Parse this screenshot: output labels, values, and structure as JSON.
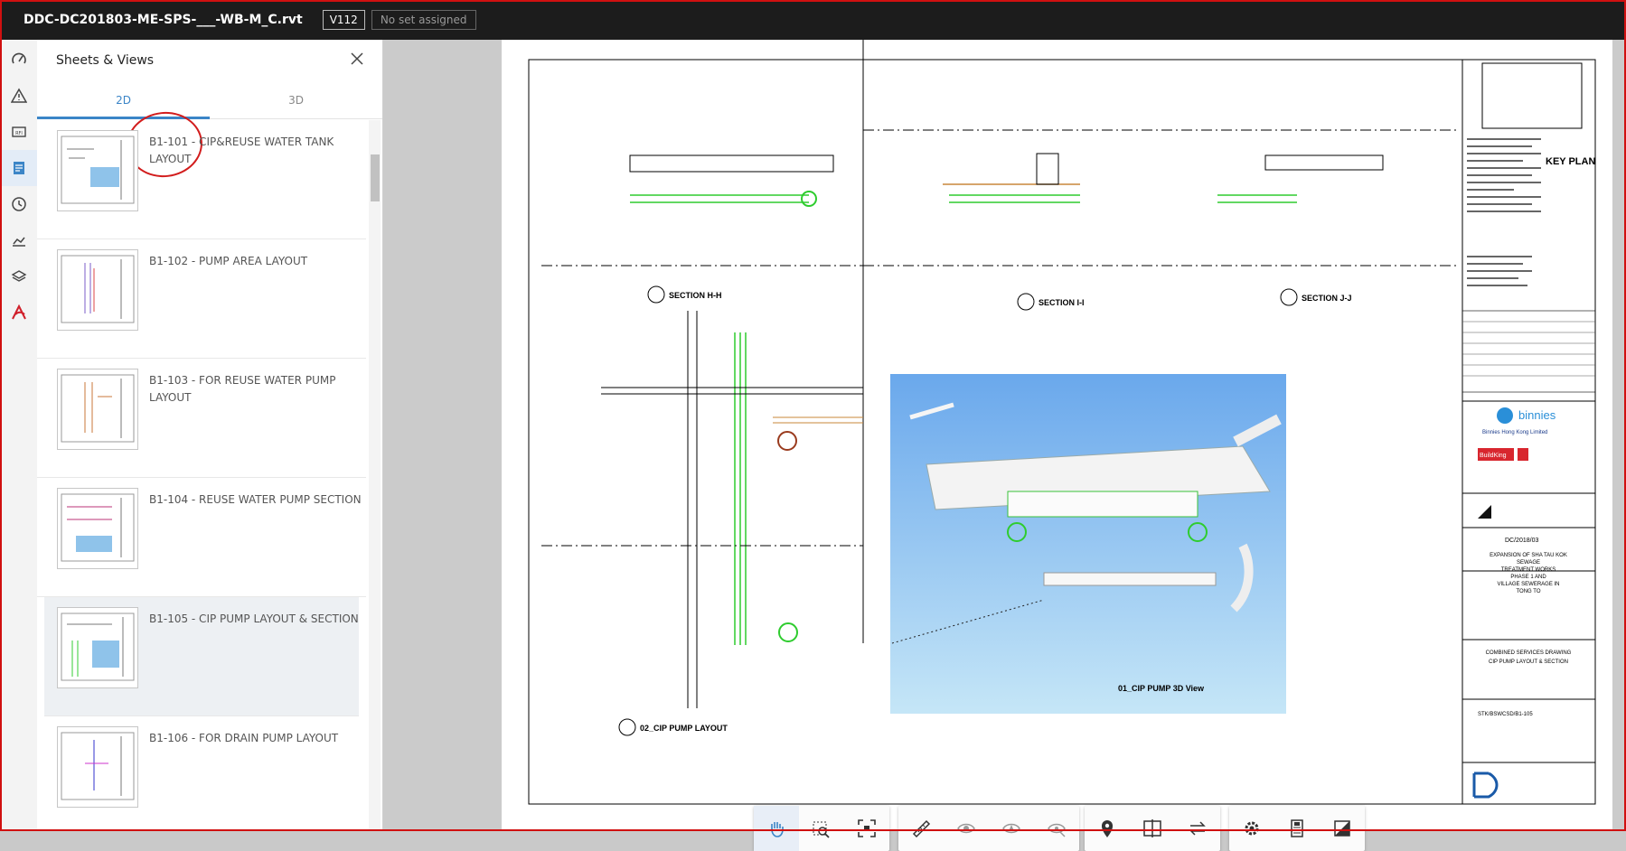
{
  "header": {
    "file_name": "DDC-DC201803-ME-SPS-___-WB-M_C.rvt",
    "version": "V112",
    "set_status": "No set assigned"
  },
  "rail": {
    "icons": [
      "dashboard-icon",
      "warning-icon",
      "rfi-icon",
      "sheets-icon",
      "history-icon",
      "chart-icon",
      "layers-icon",
      "autodesk-icon"
    ]
  },
  "panel": {
    "title": "Sheets & Views",
    "tabs": [
      {
        "label": "2D"
      },
      {
        "label": "3D"
      }
    ],
    "items": [
      {
        "label": "B1-101 - CIP&REUSE WATER TANK LAYOUT"
      },
      {
        "label": "B1-102 - PUMP AREA LAYOUT"
      },
      {
        "label": "B1-103 - FOR REUSE WATER PUMP LAYOUT"
      },
      {
        "label": "B1-104 - REUSE WATER PUMP SECTION"
      },
      {
        "label": "B1-105 - CIP PUMP LAYOUT & SECTION"
      },
      {
        "label": "B1-106 - FOR DRAIN PUMP LAYOUT"
      }
    ]
  },
  "drawing": {
    "sections": [
      {
        "label": "SECTION H-H"
      },
      {
        "label": "SECTION I-I"
      },
      {
        "label": "SECTION J-J"
      },
      {
        "label": "02_CIP PUMP LAYOUT"
      },
      {
        "label": "01_CIP PUMP 3D View"
      }
    ],
    "key_plan": "KEY PLAN",
    "logos": {
      "binnies": "binnies",
      "buildking": "BuildKing",
      "client": "Binnies Hong Kong Limited"
    },
    "contract_no": "DC/2018/03",
    "contract_title": [
      "EXPANSION OF SHA TAU KOK",
      "SEWAGE",
      "TREATMENT WORKS",
      "PHASE 1 AND",
      "VILLAGE SEWERAGE IN",
      "TONG TO"
    ],
    "drawing_title": [
      "COMBINED SERVICES DRAWING",
      "CIP PUMP LAYOUT & SECTION"
    ],
    "drawing_no": "STK/BSWCSD/B1-105"
  },
  "toolbar": {
    "groups": [
      [
        "pan-icon",
        "zoom-window-icon",
        "fit-to-view-icon"
      ],
      [
        "measure-icon",
        "hide-icon",
        "isolate-icon",
        "show-all-icon"
      ],
      [
        "location-icon",
        "compare-icon",
        "swap-icon"
      ],
      [
        "settings-icon",
        "properties-icon",
        "fullscreen-icon"
      ]
    ]
  }
}
